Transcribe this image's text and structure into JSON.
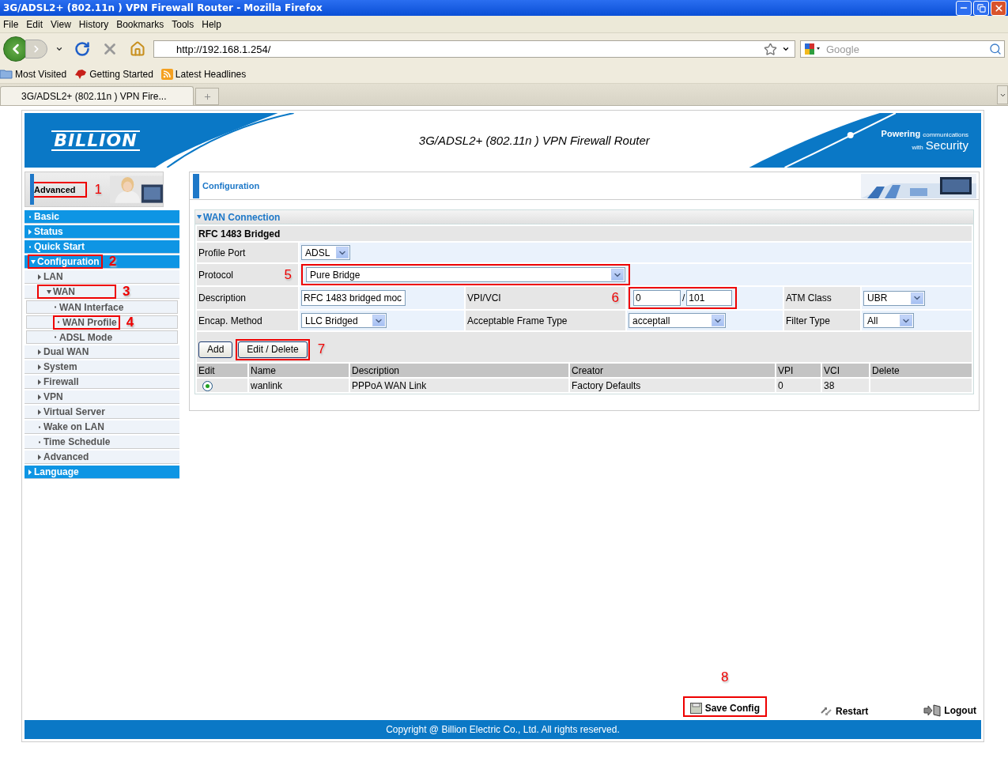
{
  "window": {
    "title": "3G/ADSL2+ (802.11n ) VPN Firewall Router - Mozilla Firefox"
  },
  "menu_bar": [
    "File",
    "Edit",
    "View",
    "History",
    "Bookmarks",
    "Tools",
    "Help"
  ],
  "toolbar": {
    "url": "http://192.168.1.254/",
    "search_placeholder": "Google"
  },
  "bookmarks": [
    "Most Visited",
    "Getting Started",
    "Latest Headlines"
  ],
  "tabs": [
    {
      "label": "3G/ADSL2+ (802.11n ) VPN Fire...",
      "selected": true
    }
  ],
  "router": {
    "logo": "BILLION",
    "title": "3G/ADSL2+ (802.11n ) VPN Firewall Router",
    "tagline": {
      "powering": "Powering",
      "communications": "communications",
      "with": "with",
      "security": "Security"
    },
    "mode": {
      "label": "Advanced",
      "callout": "1"
    },
    "nav": [
      {
        "label": "Basic",
        "kind": "link"
      },
      {
        "label": "Status",
        "kind": "group",
        "expanded": false
      },
      {
        "label": "Quick Start",
        "kind": "link"
      },
      {
        "label": "Configuration",
        "kind": "group",
        "expanded": true,
        "callout": "2",
        "children": [
          {
            "label": "LAN",
            "kind": "group",
            "expanded": false
          },
          {
            "label": "WAN",
            "kind": "group",
            "expanded": true,
            "callout": "3",
            "children": [
              {
                "label": "WAN Interface",
                "kind": "link"
              },
              {
                "label": "WAN Profile",
                "kind": "link",
                "callout": "4"
              },
              {
                "label": "ADSL Mode",
                "kind": "link"
              }
            ]
          },
          {
            "label": "Dual WAN",
            "kind": "group",
            "expanded": false
          },
          {
            "label": "System",
            "kind": "group",
            "expanded": false
          },
          {
            "label": "Firewall",
            "kind": "group",
            "expanded": false
          },
          {
            "label": "VPN",
            "kind": "group",
            "expanded": false
          },
          {
            "label": "Virtual Server",
            "kind": "group",
            "expanded": false
          },
          {
            "label": "Wake on LAN",
            "kind": "link"
          },
          {
            "label": "Time Schedule",
            "kind": "link"
          },
          {
            "label": "Advanced",
            "kind": "group",
            "expanded": false
          }
        ]
      },
      {
        "label": "Language",
        "kind": "group",
        "expanded": false
      }
    ],
    "panel_title": "Configuration",
    "section": {
      "title": "WAN Connection",
      "expanded": true
    },
    "form_title": "RFC 1483 Bridged",
    "form_rows": [
      {
        "fields": [
          {
            "label": "Profile Port",
            "control": {
              "kind": "select",
              "value": "ADSL"
            }
          }
        ]
      },
      {
        "fields": [
          {
            "label": "Protocol",
            "callout": "5",
            "control": {
              "kind": "select",
              "value": "Pure Bridge"
            }
          }
        ]
      },
      {
        "fields": [
          {
            "label": "Description",
            "control": {
              "kind": "input",
              "value": "RFC 1483 bridged moc"
            }
          },
          {
            "label": "VPI/VCI",
            "callout": "6",
            "control": {
              "kind": "pair",
              "values": [
                "0",
                "101"
              ],
              "separator": "/"
            }
          },
          {
            "label": "ATM Class",
            "control": {
              "kind": "select",
              "value": "UBR"
            }
          }
        ]
      },
      {
        "fields": [
          {
            "label": "Encap. Method",
            "control": {
              "kind": "select",
              "value": "LLC Bridged"
            }
          },
          {
            "label": "Acceptable Frame Type",
            "control": {
              "kind": "select",
              "value": "acceptall"
            }
          },
          {
            "label": "Filter Type",
            "control": {
              "kind": "select",
              "value": "All"
            }
          }
        ]
      }
    ],
    "buttons": [
      {
        "label": "Add"
      },
      {
        "label": "Edit / Delete",
        "callout": "7"
      }
    ],
    "table": {
      "columns": [
        "Edit",
        "Name",
        "Description",
        "Creator",
        "VPI",
        "VCI",
        "Delete"
      ],
      "rows": [
        {
          "selected": true,
          "cells": [
            "",
            "wanlink",
            "PPPoA WAN Link",
            "Factory Defaults",
            "0",
            "38",
            ""
          ]
        }
      ]
    },
    "actions": [
      {
        "label": "Save Config",
        "kind": "save",
        "callout": "8"
      },
      {
        "label": "Restart",
        "kind": "restart"
      },
      {
        "label": "Logout",
        "kind": "logout"
      }
    ],
    "copyright": "Copyright @ Billion Electric Co., Ltd. All rights reserved."
  }
}
